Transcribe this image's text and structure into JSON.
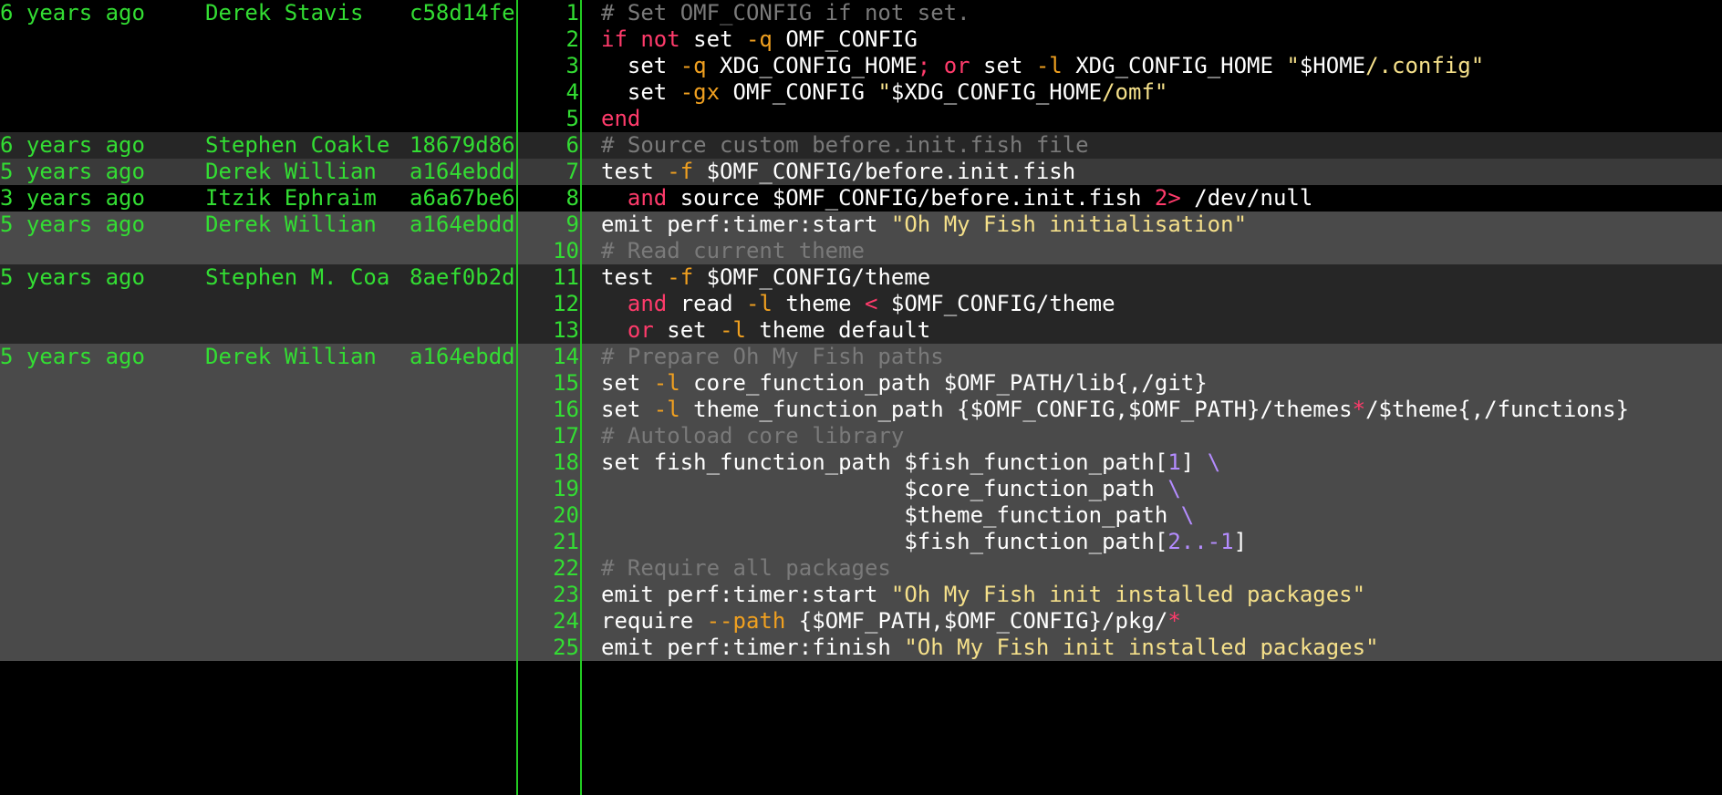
{
  "theme": {
    "background": "#000000",
    "band_colors": [
      "#000000",
      "#262626",
      "#3a3a3a",
      "#4a4a4a"
    ],
    "gutter_color": "#33dd33",
    "divider_color": "#22cc22",
    "token_colors": {
      "kw": "#ff3b6b",
      "flag": "#f0a020",
      "str": "#f5e08a",
      "cmt": "#7a7a7a",
      "num": "#b48cff",
      "pl": "#ffffff"
    }
  },
  "blame_groups": [
    {
      "date": "6 years ago",
      "author": "Derek Stavis",
      "hash": "c58d14fe",
      "lines": 5,
      "band": 0
    },
    {
      "date": "6 years ago",
      "author": "Stephen Coakle",
      "hash": "18679d86",
      "lines": 1,
      "band": 1
    },
    {
      "date": "5 years ago",
      "author": "Derek Willian",
      "hash": "a164ebdd",
      "lines": 1,
      "band": 2
    },
    {
      "date": "3 years ago",
      "author": "Itzik Ephraim",
      "hash": "a6a67be6",
      "lines": 1,
      "band": 0
    },
    {
      "date": "5 years ago",
      "author": "Derek Willian",
      "hash": "a164ebdd",
      "lines": 2,
      "band": 3
    },
    {
      "date": "5 years ago",
      "author": "Stephen M. Coa",
      "hash": "8aef0b2d",
      "lines": 3,
      "band": 1
    },
    {
      "date": "5 years ago",
      "author": "Derek Willian",
      "hash": "a164ebdd",
      "lines": 12,
      "band": 3
    }
  ],
  "code_lines": [
    [
      [
        "cmt",
        "# Set OMF_CONFIG if not set."
      ]
    ],
    [
      [
        "kw",
        "if"
      ],
      [
        "pl",
        " "
      ],
      [
        "kw",
        "not"
      ],
      [
        "pl",
        " set "
      ],
      [
        "flag",
        "-q"
      ],
      [
        "pl",
        " OMF_CONFIG"
      ]
    ],
    [
      [
        "pl",
        "  set "
      ],
      [
        "flag",
        "-q"
      ],
      [
        "pl",
        " XDG_CONFIG_HOME"
      ],
      [
        "kw",
        ";"
      ],
      [
        "pl",
        " "
      ],
      [
        "kw",
        "or"
      ],
      [
        "pl",
        " set "
      ],
      [
        "flag",
        "-l"
      ],
      [
        "pl",
        " XDG_CONFIG_HOME "
      ],
      [
        "str",
        "\""
      ],
      [
        "pl",
        "$HOME"
      ],
      [
        "str",
        "/.config\""
      ]
    ],
    [
      [
        "pl",
        "  set "
      ],
      [
        "flag",
        "-gx"
      ],
      [
        "pl",
        " OMF_CONFIG "
      ],
      [
        "str",
        "\""
      ],
      [
        "pl",
        "$XDG_CONFIG_HOME"
      ],
      [
        "str",
        "/omf\""
      ]
    ],
    [
      [
        "kw",
        "end"
      ]
    ],
    [
      [
        "cmt",
        "# Source custom before.init.fish file"
      ]
    ],
    [
      [
        "pl",
        "test "
      ],
      [
        "flag",
        "-f"
      ],
      [
        "pl",
        " $OMF_CONFIG/before.init.fish"
      ]
    ],
    [
      [
        "pl",
        "  "
      ],
      [
        "kw",
        "and"
      ],
      [
        "pl",
        " source $OMF_CONFIG/before.init.fish "
      ],
      [
        "kw",
        "2>"
      ],
      [
        "pl",
        " /dev/null"
      ]
    ],
    [
      [
        "pl",
        "emit perf:timer:start "
      ],
      [
        "str",
        "\"Oh My Fish initialisation\""
      ]
    ],
    [
      [
        "cmt",
        "# Read current theme"
      ]
    ],
    [
      [
        "pl",
        "test "
      ],
      [
        "flag",
        "-f"
      ],
      [
        "pl",
        " $OMF_CONFIG/theme"
      ]
    ],
    [
      [
        "pl",
        "  "
      ],
      [
        "kw",
        "and"
      ],
      [
        "pl",
        " read "
      ],
      [
        "flag",
        "-l"
      ],
      [
        "pl",
        " theme "
      ],
      [
        "kw",
        "<"
      ],
      [
        "pl",
        " $OMF_CONFIG/theme"
      ]
    ],
    [
      [
        "pl",
        "  "
      ],
      [
        "kw",
        "or"
      ],
      [
        "pl",
        " set "
      ],
      [
        "flag",
        "-l"
      ],
      [
        "pl",
        " theme default"
      ]
    ],
    [
      [
        "cmt",
        "# Prepare Oh My Fish paths"
      ]
    ],
    [
      [
        "pl",
        "set "
      ],
      [
        "flag",
        "-l"
      ],
      [
        "pl",
        " core_function_path $OMF_PATH/lib{,/git}"
      ]
    ],
    [
      [
        "pl",
        "set "
      ],
      [
        "flag",
        "-l"
      ],
      [
        "pl",
        " theme_function_path {$OMF_CONFIG,$OMF_PATH}/themes"
      ],
      [
        "kw",
        "*"
      ],
      [
        "pl",
        "/$theme{,/functions}"
      ]
    ],
    [
      [
        "cmt",
        "# Autoload core library"
      ]
    ],
    [
      [
        "pl",
        "set fish_function_path $fish_function_path["
      ],
      [
        "num",
        "1"
      ],
      [
        "pl",
        "] "
      ],
      [
        "num",
        "\\"
      ]
    ],
    [
      [
        "pl",
        "                       $core_function_path "
      ],
      [
        "num",
        "\\"
      ]
    ],
    [
      [
        "pl",
        "                       $theme_function_path "
      ],
      [
        "num",
        "\\"
      ]
    ],
    [
      [
        "pl",
        "                       $fish_function_path["
      ],
      [
        "num",
        "2..-1"
      ],
      [
        "pl",
        "]"
      ]
    ],
    [
      [
        "cmt",
        "# Require all packages"
      ]
    ],
    [
      [
        "pl",
        "emit perf:timer:start "
      ],
      [
        "str",
        "\"Oh My Fish init installed packages\""
      ]
    ],
    [
      [
        "pl",
        "require "
      ],
      [
        "flag",
        "--path"
      ],
      [
        "pl",
        " {$OMF_PATH,$OMF_CONFIG}/pkg/"
      ],
      [
        "kw",
        "*"
      ]
    ],
    [
      [
        "pl",
        "emit perf:timer:finish "
      ],
      [
        "str",
        "\"Oh My Fish init installed packages\""
      ]
    ]
  ]
}
